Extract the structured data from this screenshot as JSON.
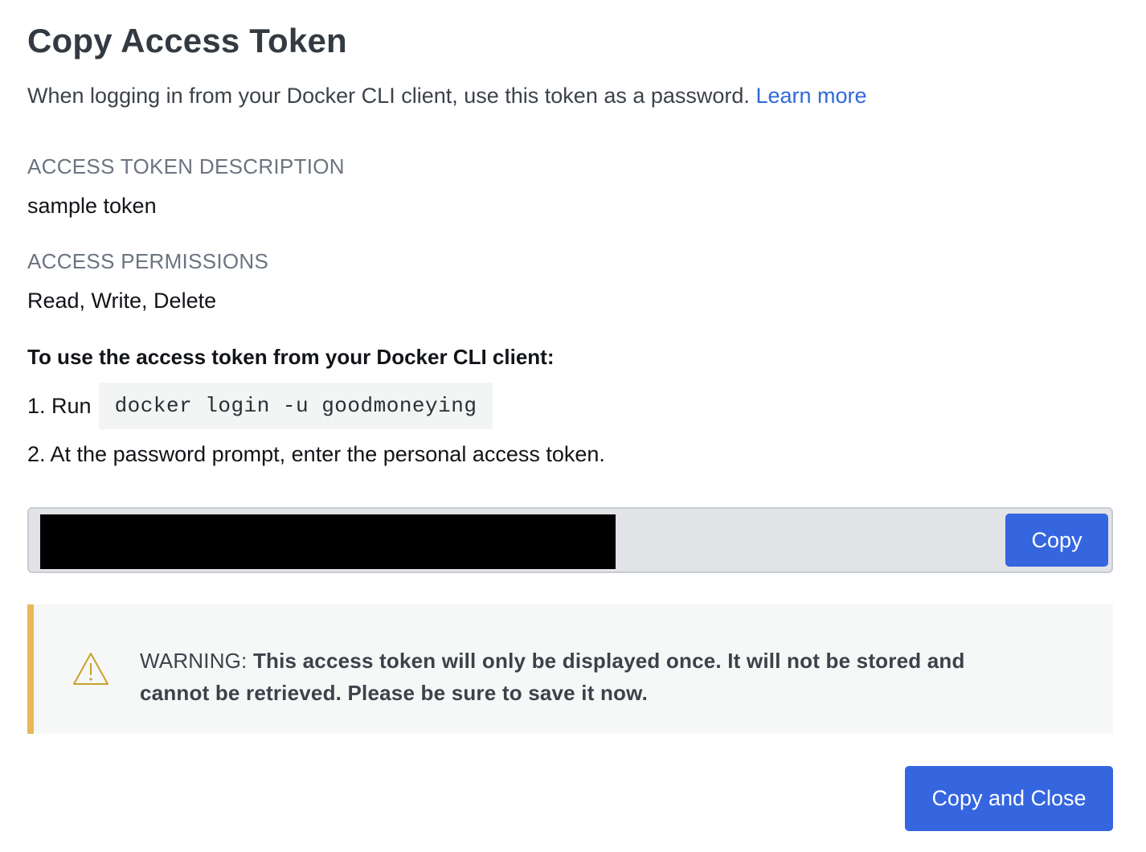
{
  "dialog": {
    "title": "Copy Access Token",
    "subtitle": "When logging in from your Docker CLI client, use this token as a password.",
    "learn_more": "Learn more"
  },
  "description": {
    "label": "ACCESS TOKEN DESCRIPTION",
    "value": "sample token"
  },
  "permissions": {
    "label": "ACCESS PERMISSIONS",
    "value": "Read, Write, Delete"
  },
  "instructions": {
    "heading": "To use the access token from your Docker CLI client:",
    "step1_prefix": "1. Run",
    "step1_command": "docker login -u goodmoneying",
    "step2": "2. At the password prompt, enter the personal access token."
  },
  "token": {
    "copy_label": "Copy"
  },
  "warning": {
    "icon": "warning-triangle-icon",
    "prefix": "WARNING:",
    "message": "This access token will only be displayed once. It will not be stored and cannot be retrieved. Please be sure to save it now."
  },
  "footer": {
    "copy_close_label": "Copy and Close"
  },
  "colors": {
    "primary": "#3566e0",
    "link": "#2f6ad8",
    "warning_accent": "#e8b85b",
    "warning_icon": "#c9a227"
  }
}
